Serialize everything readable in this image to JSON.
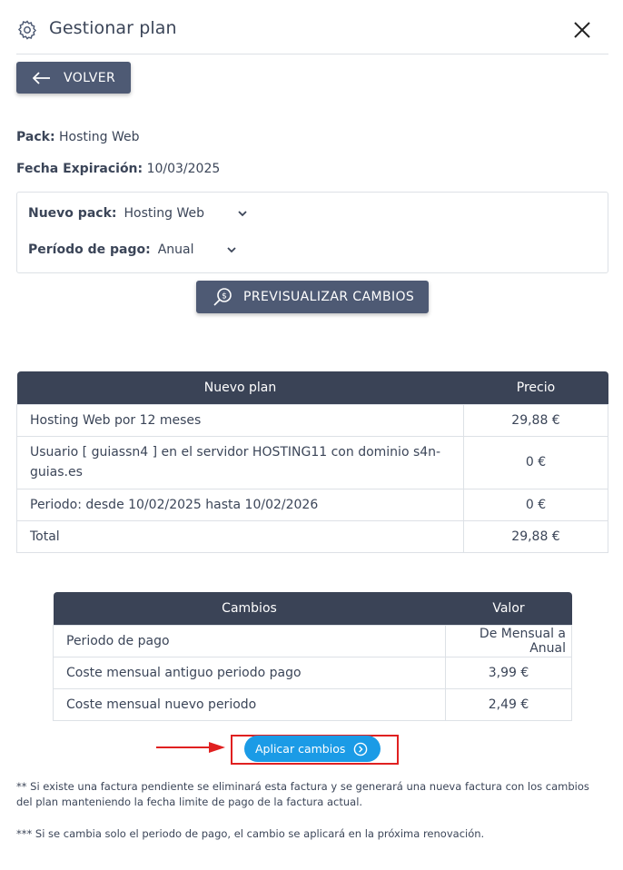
{
  "dialog": {
    "title": "Gestionar plan",
    "icon": "gear-icon",
    "close_icon": "close-icon"
  },
  "back_button": {
    "label": "VOLVER",
    "icon": "arrow-left-icon"
  },
  "info": {
    "pack_label": "Pack:",
    "pack_value": "Hosting Web",
    "expiration_label": "Fecha Expiración:",
    "expiration_value": "10/03/2025"
  },
  "form": {
    "new_pack_label": "Nuevo pack:",
    "new_pack_value": "Hosting Web",
    "period_label": "Período de pago:",
    "period_value": "Anual"
  },
  "preview_button": {
    "label": "PREVISUALIZAR CAMBIOS",
    "icon": "search-money-icon"
  },
  "plan_table": {
    "headers": [
      "Nuevo plan",
      "Precio"
    ],
    "rows": [
      [
        "Hosting Web por 12 meses",
        "29,88 €"
      ],
      [
        "Usuario [ guiassn4 ] en el servidor HOSTING11 con dominio s4n-guias.es",
        "0 €"
      ],
      [
        "Periodo: desde 10/02/2025 hasta 10/02/2026",
        "0 €"
      ],
      [
        "Total",
        "29,88 €"
      ]
    ]
  },
  "changes_table": {
    "headers": [
      "Cambios",
      "Valor"
    ],
    "rows": [
      [
        "Periodo de pago",
        "De Mensual a Anual"
      ],
      [
        "Coste mensual antiguo periodo pago",
        "3,99 €"
      ],
      [
        "Coste mensual nuevo periodo",
        "2,49 €"
      ]
    ]
  },
  "apply_button": {
    "label": "Aplicar cambios",
    "icon": "arrow-circle-right-icon"
  },
  "notes": {
    "note1": "** Si existe una factura pendiente se eliminará esta factura y se generará una nueva factura con los cambios del plan manteniendo la fecha limite de pago de la factura actual.",
    "note2": "*** Si se cambia solo el periodo de pago, el cambio se aplicará en la próxima renovación."
  },
  "colors": {
    "dark_button": "#4e5a74",
    "table_header": "#3a4356",
    "accent_blue": "#1b9be6",
    "annotation_red": "#e02020"
  }
}
